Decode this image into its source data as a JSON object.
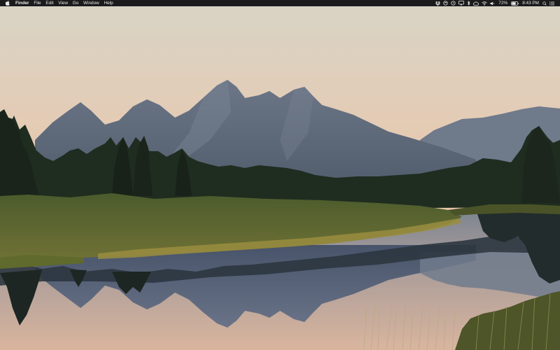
{
  "menubar": {
    "apple_menu_icon": "apple-icon",
    "app_name": "Finder",
    "menus": [
      "File",
      "Edit",
      "View",
      "Go",
      "Window",
      "Help"
    ],
    "status_icons": [
      "dropbox-icon",
      "sync-icon",
      "time-machine-icon",
      "display-icon",
      "bluetooth-icon",
      "creative-cloud-icon",
      "wifi-icon",
      "volume-icon"
    ],
    "battery_percent": "72%",
    "battery_level": 0.72,
    "time": "8:43 PM",
    "search_icon": "spotlight-search-icon",
    "menu_icon": "notification-center-icon",
    "background_color": "#1b1b1d",
    "text_color": "#eaeaea"
  },
  "wallpaper": {
    "subject": "grand-teton-mountains-at-dusk",
    "sky_top_color": "#ddd6c6",
    "sky_horizon_color": "#edbf9b",
    "mountain_color": "#5f6b7c",
    "forest_color": "#1e2b1e",
    "water_color": "#b8a39a"
  }
}
